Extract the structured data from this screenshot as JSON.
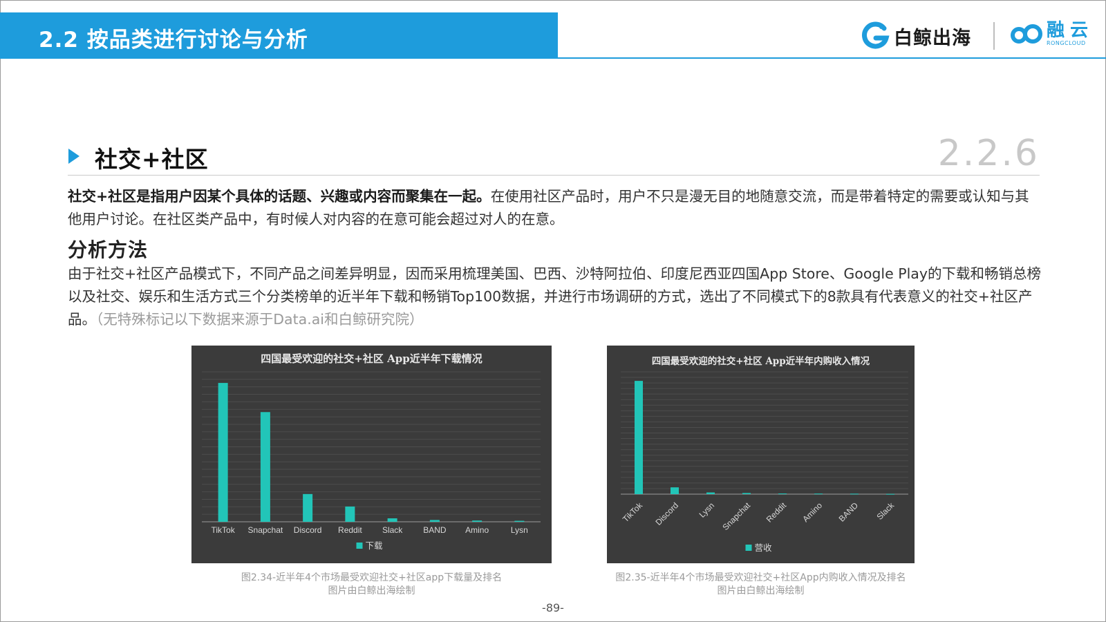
{
  "header": {
    "title": "2.2 按品类进行讨论与分析",
    "logo_baijing": "白鲸出海",
    "logo_rong_name": "融云",
    "logo_rong_sub": "RONGCLOUD",
    "accent": "#1e9cdc"
  },
  "section": {
    "title": "社交+社区",
    "number": "2.2.6"
  },
  "intro": {
    "bold": "社交+社区是指用户因某个具体的话题、兴趣或内容而聚集在一起。",
    "rest": "在使用社区产品时，用户不只是漫无目的地随意交流，而是带着特定的需要或认知与其他用户讨论。在社区类产品中，有时候人对内容的在意可能会超过对人的在意。"
  },
  "method": {
    "title": "分析方法",
    "text": "由于社交+社区产品模式下，不同产品之间差异明显，因而采用梳理美国、巴西、沙特阿拉伯、印度尼西亚四国App Store、Google Play的下载和畅销总榜以及社交、娱乐和生活方式三个分类榜单的近半年下载和畅销Top100数据，并进行市场调研的方式，选出了不同模式下的8款具有代表意义的社交+社区产品。",
    "note": "（无特殊标记以下数据来源于Data.ai和白鲸研究院）"
  },
  "chart_data": [
    {
      "type": "bar",
      "title": "四国最受欢迎的社交+社区 App近半年下载情况",
      "categories": [
        "TikTok",
        "Snapchat",
        "Discord",
        "Reddit",
        "Slack",
        "BAND",
        "Amino",
        "Lysn"
      ],
      "series": [
        {
          "name": "下载",
          "values": [
            100,
            79,
            20,
            11,
            2.5,
            1.3,
            0.9,
            0.7
          ]
        }
      ],
      "ylim": [
        0,
        108
      ],
      "grid": true,
      "legend": "bottom",
      "bar_color": "#22c5b8",
      "background": "#3b3b3b"
    },
    {
      "type": "bar",
      "title": "四国最受欢迎的社交+社区 App近半年内购收入情况",
      "categories": [
        "TikTok",
        "Discord",
        "Lysn",
        "Snapchat",
        "Reddit",
        "Amino",
        "BAND",
        "Slack"
      ],
      "series": [
        {
          "name": "营收",
          "values": [
            100,
            6,
            1.5,
            1.0,
            0.6,
            0.5,
            0.4,
            0.2
          ]
        }
      ],
      "ylim": [
        0,
        108
      ],
      "grid": true,
      "legend": "bottom",
      "bar_color": "#22c5b8",
      "background": "#3b3b3b"
    }
  ],
  "captions": [
    {
      "line1": "图2.34-近半年4个市场最受欢迎社交+社区app下载量及排名",
      "line2": "图片由白鲸出海绘制"
    },
    {
      "line1": "图2.35-近半年4个市场最受欢迎社交+社区App内购收入情况及排名",
      "line2": "图片由白鲸出海绘制"
    }
  ],
  "page_number": "-89-"
}
